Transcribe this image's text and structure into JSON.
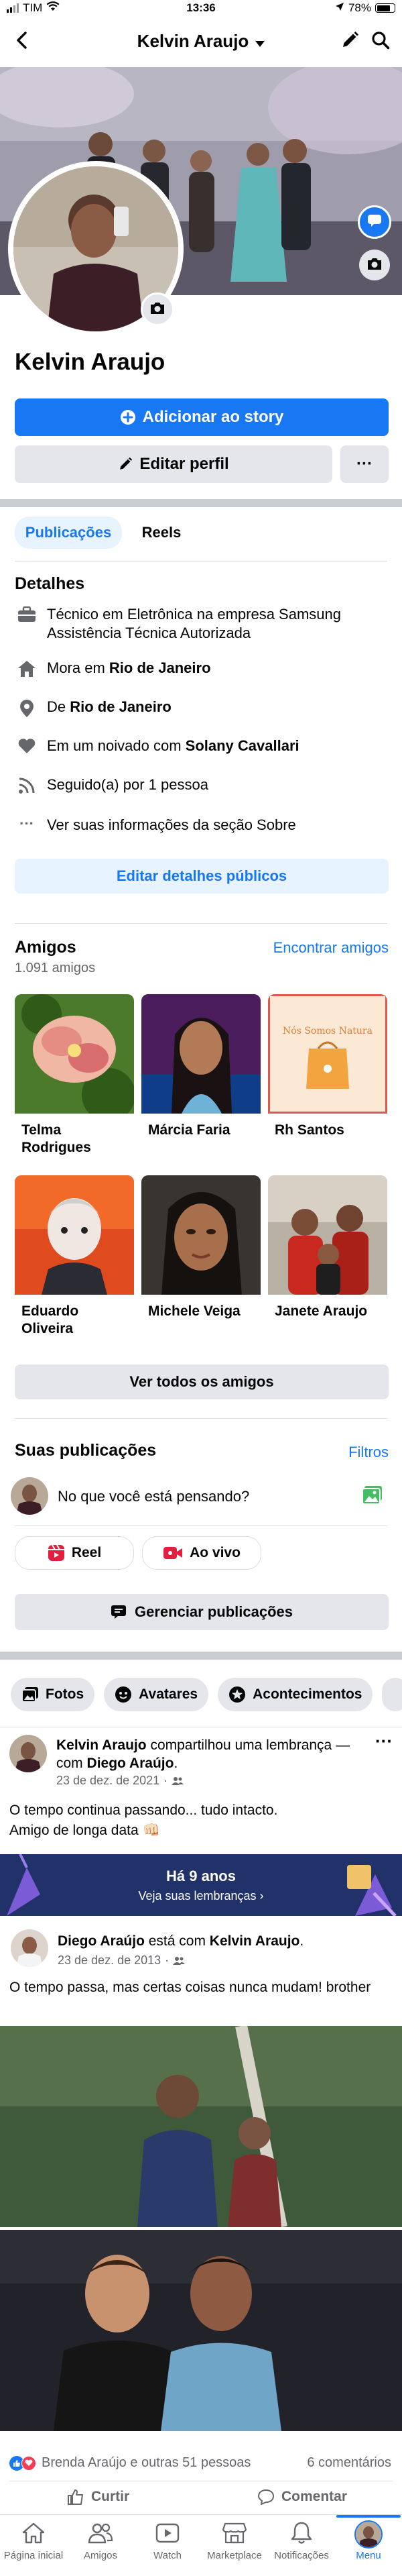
{
  "status_bar": {
    "carrier": "TIM",
    "time": "13:36",
    "battery": "78%"
  },
  "nav": {
    "title": "Kelvin Araujo"
  },
  "profile": {
    "name": "Kelvin Araujo",
    "add_story_label": "Adicionar ao story",
    "edit_profile_label": "Editar perfil",
    "more_label": "···"
  },
  "tabs": {
    "posts": "Publicações",
    "reels": "Reels"
  },
  "details": {
    "title": "Detalhes",
    "work": "Técnico em Eletrônica na empresa Samsung Assistência Técnica Autorizada",
    "lives_prefix": "Mora em",
    "lives_city": "Rio de Janeiro",
    "from_prefix": "De",
    "from_city": "Rio de Janeiro",
    "relationship_prefix": "Em um noivado com",
    "relationship_partner": "Solany Cavallari",
    "followers": "Seguido(a) por 1 pessoa",
    "about_link": "Ver suas informações da seção Sobre",
    "edit_details": "Editar detalhes públicos"
  },
  "friends": {
    "title": "Amigos",
    "count": "1.091 amigos",
    "find_link": "Encontrar amigos",
    "list": [
      {
        "name": "Telma Rodrigues"
      },
      {
        "name": "Márcia Faria"
      },
      {
        "name": "Rh Santos"
      },
      {
        "name": "Eduardo Oliveira"
      },
      {
        "name": "Michele Veiga"
      },
      {
        "name": "Janete Araujo"
      }
    ],
    "rh_card_text": "Nós Somos Natura",
    "see_all": "Ver todos os amigos"
  },
  "posts_section": {
    "title": "Suas publicações",
    "filters": "Filtros",
    "composer_placeholder": "No que você está pensando?",
    "reel_label": "Reel",
    "live_label": "Ao vivo",
    "manage_label": "Gerenciar publicações"
  },
  "chips": {
    "photos": "Fotos",
    "avatars": "Avatares",
    "events": "Acontecimentos"
  },
  "memory_post": {
    "author": "Kelvin Araujo",
    "action": "compartilhou uma lembrança — com",
    "with": "Diego Araújo",
    "date": "23 de dez. de 2021",
    "text_line1": "O tempo continua passando... tudo intacto.",
    "text_line2": "Amigo de longa data 👊🏻",
    "banner_title": "Há 9 anos",
    "banner_sub": "Veja suas lembranças ›"
  },
  "shared_post": {
    "author": "Diego Araújo",
    "action": "está com",
    "with": "Kelvin Araujo",
    "date": "23 de dez. de 2013",
    "text": "O tempo passa, mas certas coisas nunca mudam! brother"
  },
  "reactions": {
    "summary": "Brenda Araújo e outras 51 pessoas",
    "comments": "6 comentários",
    "like_label": "Curtir",
    "comment_label": "Comentar"
  },
  "tabbar": {
    "home": "Página inicial",
    "friends": "Amigos",
    "watch": "Watch",
    "marketplace": "Marketplace",
    "notifications": "Notificações",
    "menu": "Menu"
  },
  "colors": {
    "brand": "#1877f2",
    "light_blue": "#e7f3ff",
    "grey_button": "#e4e6eb",
    "divider": "#c9ccd1"
  }
}
